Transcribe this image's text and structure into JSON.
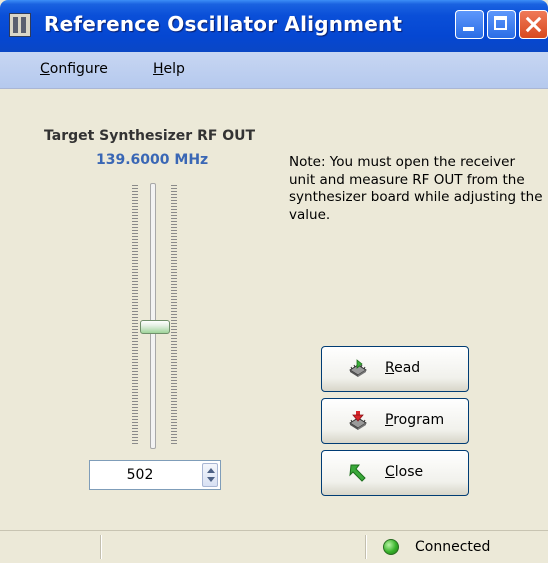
{
  "window": {
    "title": "Reference Oscillator Alignment",
    "title_icon": "app-icon",
    "controls": [
      "minimize-icon",
      "maximize-icon",
      "close-icon"
    ]
  },
  "menu": {
    "configure": {
      "accel": "C",
      "rest": "onfigure"
    },
    "help": {
      "accel": "H",
      "rest": "elp"
    }
  },
  "synth": {
    "label": "Target Synthesizer RF OUT",
    "frequency": "139.6000 MHz",
    "slider_position": 0.55,
    "spin_value": "502"
  },
  "note": "Note: You must open the receiver unit and measure RF OUT from the synthesizer board while adjusting the value.",
  "buttons": {
    "read": {
      "accel": "R",
      "rest": "ead",
      "icon": "read-chip-icon"
    },
    "program": {
      "accel": "P",
      "rest": "rogram",
      "icon": "program-chip-icon"
    },
    "close": {
      "accel": "C",
      "rest": "lose",
      "icon": "close-arrow-icon"
    }
  },
  "status": {
    "text": "Connected",
    "indicator_color": "#37b12a"
  }
}
